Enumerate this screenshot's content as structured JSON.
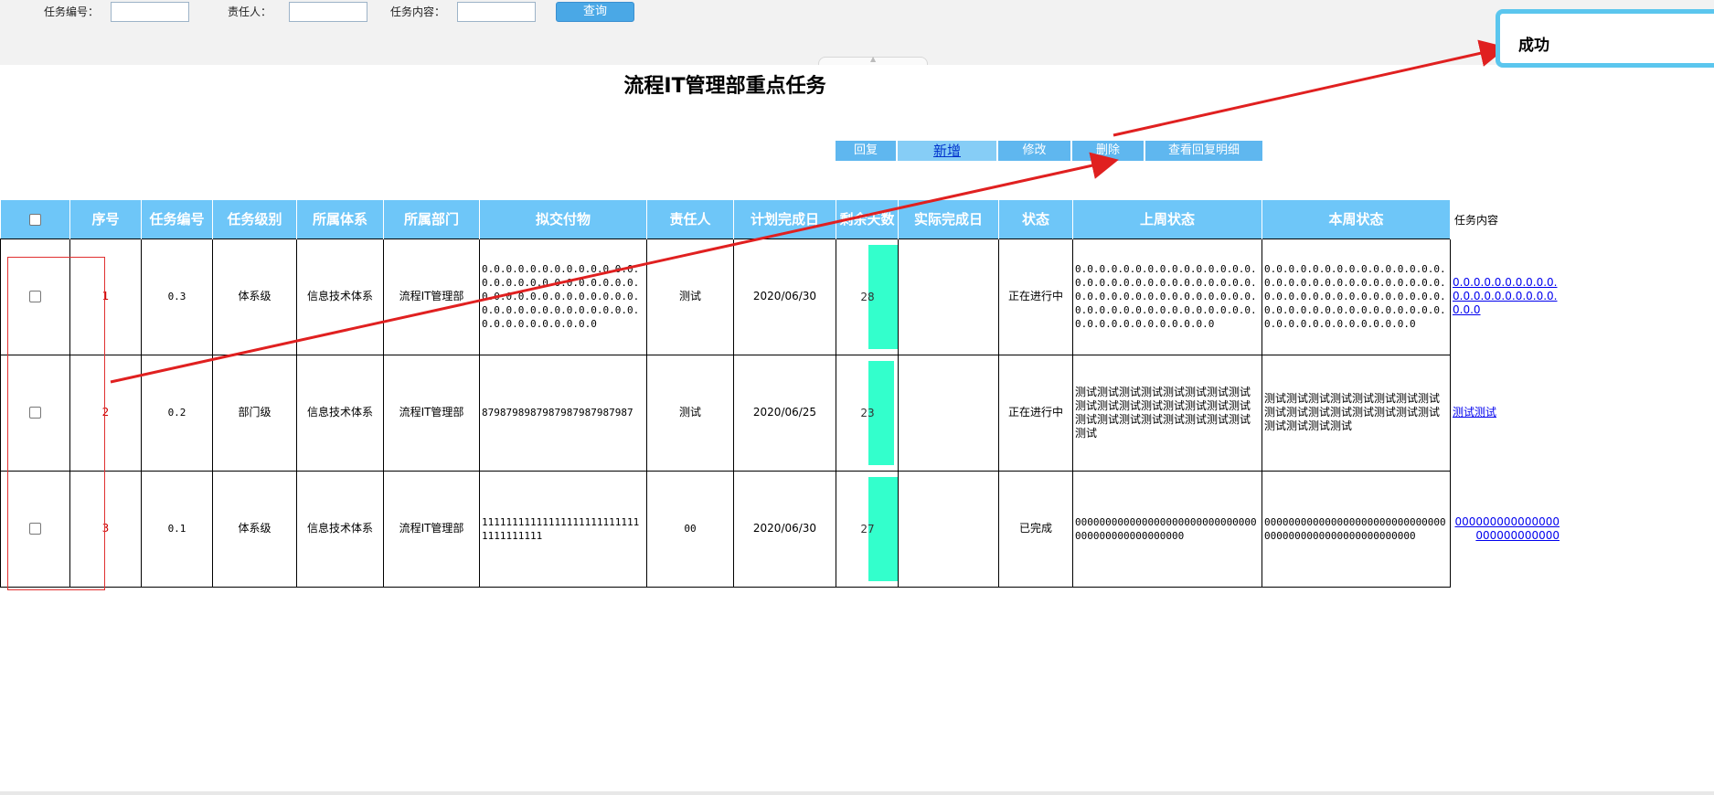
{
  "search": {
    "task_no_label": "任务编号：",
    "owner_label": "责任人：",
    "content_label": "任务内容：",
    "task_no_value": "",
    "owner_value": "",
    "content_value": "",
    "query_label": "查询"
  },
  "page_title": "流程IT管理部重点任务",
  "toolbar": {
    "reply": "回复",
    "add": "新增",
    "edit": "修改",
    "delete": "删除",
    "view_reply": "查看回复明细"
  },
  "table": {
    "headers": [
      "序号",
      "任务编号",
      "任务级别",
      "所属体系",
      "所属部门",
      "拟交付物",
      "责任人",
      "计划完成日",
      "剩余天数",
      "实际完成日",
      "状态",
      "上周状态",
      "本周状态",
      "任务内容"
    ],
    "rows": [
      {
        "seq": "1",
        "task_no": "0.3",
        "level": "体系级",
        "system": "信息技术体系",
        "dept": "流程IT管理部",
        "deliverable": "0.0.0.0.0.0.0.0.0.0.0.0.0.0.0.0.0.0.0.0.0.0.0.0.0.0.0.0.0.0.0.0.0.0.0.0.0.0.0.0.0.0.0.0.0.0.0.0.0.0.0.0.0.0.0.0.0.0.0.0.0.0",
        "owner": "测试",
        "plan_date": "2020/06/30",
        "remaining_days": "28",
        "actual_date": "",
        "status": "正在进行中",
        "last_week": "0.0.0.0.0.0.0.0.0.0.0.0.0.0.0.0.0.0.0.0.0.0.0.0.0.0.0.0.0.0.0.0.0.0.0.0.0.0.0.0.0.0.0.0.0.0.0.0.0.0.0.0.0.0.0.0.0.0.0.0.0.0.0.0.0.0.0.0.0.0.0.0",
        "this_week": "0.0.0.0.0.0.0.0.0.0.0.0.0.0.0.0.0.0.0.0.0.0.0.0.0.0.0.0.0.0.0.0.0.0.0.0.0.0.0.0.0.0.0.0.0.0.0.0.0.0.0.0.0.0.0.0.0.0.0.0.0.0.0.0.0.0.0.0.0.0.0.0.0",
        "content": "0.0.0.0.0.0.0.0.0.0.0.0.0.0.0.0.0.0.0.0.0.0.0"
      },
      {
        "seq": "2",
        "task_no": "0.2",
        "level": "部门级",
        "system": "信息技术体系",
        "dept": "流程IT管理部",
        "deliverable": "8798798987987987987987987",
        "owner": "测试",
        "plan_date": "2020/06/25",
        "remaining_days": "23",
        "actual_date": "",
        "status": "正在进行中",
        "last_week": "测试测试测试测试测试测试测试测试测试测试测试测试测试测试测试测试测试测试测试测试测试测试测试测试测试",
        "this_week": "测试测试测试测试测试测试测试测试测试测试测试测试测试测试测试测试测试测试测试测试",
        "content": "测试测试"
      },
      {
        "seq": "3",
        "task_no": "0.1",
        "level": "体系级",
        "system": "信息技术体系",
        "dept": "流程IT管理部",
        "deliverable": "111111111111111111111111111111111111",
        "owner": "00",
        "plan_date": "2020/06/30",
        "remaining_days": "27",
        "actual_date": "",
        "status": "已完成",
        "last_week": "000000000000000000000000000000000000000000000000",
        "this_week": "0000000000000000000000000000000000000000000000000000000",
        "content": "000000000000000000000000000"
      }
    ]
  },
  "toast": {
    "message": "成功"
  },
  "colors": {
    "header_bg": "#6ec6f8",
    "toolbar_bg": "#5fb7ef",
    "remaining_bar": "#33ffcc",
    "annotation_red": "#e03030",
    "toast_border": "#5bc6ee"
  }
}
